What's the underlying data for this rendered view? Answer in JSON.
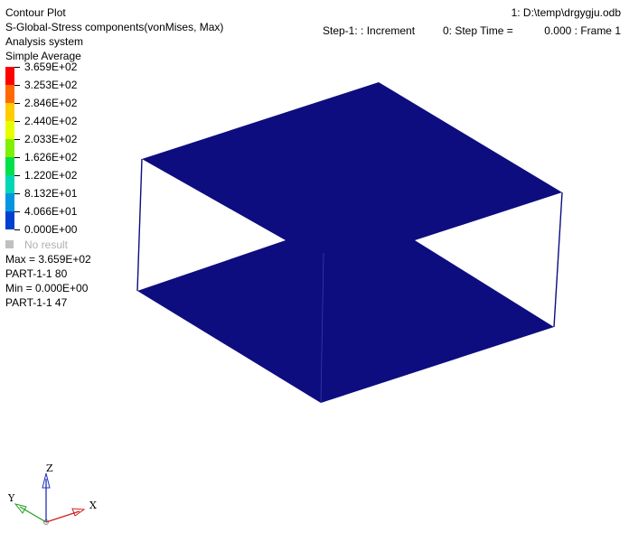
{
  "header": {
    "title": "Contour Plot",
    "variable": "S-Global-Stress components(vonMises, Max)",
    "system": "Analysis system",
    "averaging": "Simple Average",
    "file": "1: D:\\temp\\drgygju.odb",
    "step": "Step-1: : Increment",
    "step_time": "0: Step Time =",
    "frame": "0.000 : Frame 1"
  },
  "legend": {
    "levels": [
      {
        "label": "3.659E+02",
        "color": "#ff0000"
      },
      {
        "label": "3.253E+02",
        "color": "#ff6a00"
      },
      {
        "label": "2.846E+02",
        "color": "#ffcc00"
      },
      {
        "label": "2.440E+02",
        "color": "#e5ff00"
      },
      {
        "label": "2.033E+02",
        "color": "#7ff000"
      },
      {
        "label": "1.626E+02",
        "color": "#00e04a"
      },
      {
        "label": "1.220E+02",
        "color": "#00d8b5"
      },
      {
        "label": "8.132E+01",
        "color": "#0096e0"
      },
      {
        "label": "4.066E+01",
        "color": "#0040d0"
      },
      {
        "label": "0.000E+00",
        "color": "#0000a8"
      }
    ],
    "no_result": "No result",
    "no_result_color": "#c0c0c0"
  },
  "stats": {
    "max": "Max = 3.659E+02",
    "max_location": "PART-1-1 80",
    "min": "Min = 0.000E+00",
    "min_location": "PART-1-1 47"
  },
  "axes": {
    "x": "X",
    "y": "Y",
    "z": "Z"
  },
  "colors": {
    "part_fill": "#0d0d80"
  }
}
